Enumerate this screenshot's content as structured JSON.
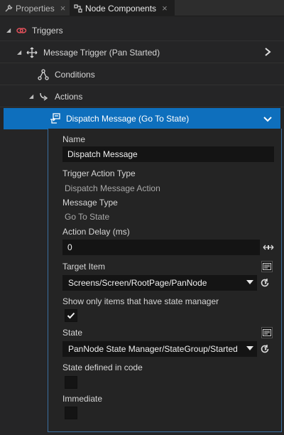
{
  "tabs": [
    {
      "label": "Properties",
      "icon": "wrench-icon",
      "close": "×"
    },
    {
      "label": "Node Components",
      "icon": "components-icon",
      "close": "×"
    }
  ],
  "tree": {
    "triggers": {
      "label": "Triggers",
      "icon": "trigger-link-icon"
    },
    "message_trigger": {
      "label": "Message Trigger (Pan Started)",
      "icon": "move-arrows-icon"
    },
    "conditions": {
      "label": "Conditions",
      "icon": "conditions-icon"
    },
    "actions": {
      "label": "Actions",
      "icon": "actions-arrow-icon"
    },
    "dispatch": {
      "label": "Dispatch Message (Go To State)",
      "icon": "dispatch-icon"
    }
  },
  "details": {
    "name_label": "Name",
    "name_value": "Dispatch Message",
    "trigger_action_type_label": "Trigger Action Type",
    "trigger_action_type_value": "Dispatch Message Action",
    "message_type_label": "Message Type",
    "message_type_value": "Go To State",
    "action_delay_label": "Action Delay (ms)",
    "action_delay_value": "0",
    "target_item_label": "Target Item",
    "target_item_value": "Screens/Screen/RootPage/PanNode",
    "show_only_label": "Show only items that have state manager",
    "show_only_checked": true,
    "state_label": "State",
    "state_value": "PanNode State Manager/StateGroup/Started",
    "state_in_code_label": "State defined in code",
    "state_in_code_checked": false,
    "immediate_label": "Immediate",
    "immediate_checked": false
  },
  "colors": {
    "selected_row": "#0e6fbd",
    "panel_bg": "#252526",
    "input_bg": "#141414",
    "trigger_icon": "#e0505a"
  }
}
